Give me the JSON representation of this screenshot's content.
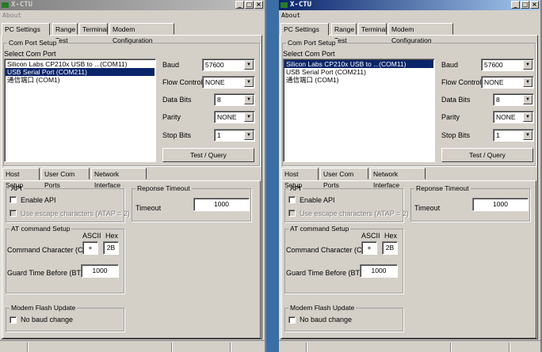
{
  "windows": [
    {
      "title": "X-CTU",
      "active": false,
      "menu": {
        "about": "About"
      },
      "tabs": [
        "PC Settings",
        "Range Test",
        "Terminal",
        "Modem Configuration"
      ],
      "com_port_setup": {
        "group_label": "Com Port Setup",
        "select_label": "Select Com Port",
        "ports": [
          "Silicon Labs CP210x USB to ...(COM11)",
          "USB Serial Port (COM211)",
          "通信端口 (COM1)"
        ],
        "selected_index": 1,
        "baud": {
          "label": "Baud",
          "value": "57600"
        },
        "flow_control": {
          "label": "Flow Control",
          "value": "NONE"
        },
        "data_bits": {
          "label": "Data Bits",
          "value": "8"
        },
        "parity": {
          "label": "Parity",
          "value": "NONE"
        },
        "stop_bits": {
          "label": "Stop Bits",
          "value": "1"
        },
        "test_query": "Test / Query"
      },
      "sub_tabs": [
        "Host Setup",
        "User Com Ports",
        "Network Interface"
      ],
      "api": {
        "group_label": "API",
        "enable_api": "Enable API",
        "escape_chars": "Use escape characters (ATAP = 2)"
      },
      "timeout": {
        "group_label": "Reponse Timeout",
        "label": "Timeout",
        "value": "1000"
      },
      "at_setup": {
        "group_label": "AT command Setup",
        "ascii_label": "ASCII",
        "hex_label": "Hex",
        "cc_label": "Command Character (CC)",
        "cc_ascii": "+",
        "cc_hex": "2B",
        "bt_label": "Guard Time Before (BT)",
        "bt_value": "1000"
      },
      "flash": {
        "group_label": "Modem Flash Update",
        "no_baud_change": "No baud change"
      }
    },
    {
      "title": "X-CTU",
      "active": true,
      "menu": {
        "about": "About"
      },
      "tabs": [
        "PC Settings",
        "Range Test",
        "Terminal",
        "Modem Configuration"
      ],
      "com_port_setup": {
        "group_label": "Com Port Setup",
        "select_label": "Select Com Port",
        "ports": [
          "Silicon Labs CP210x USB to ...(COM11)",
          "USB Serial Port (COM211)",
          "通信端口 (COM1)"
        ],
        "selected_index": 0,
        "baud": {
          "label": "Baud",
          "value": "57600"
        },
        "flow_control": {
          "label": "Flow Control",
          "value": "NONE"
        },
        "data_bits": {
          "label": "Data Bits",
          "value": "8"
        },
        "parity": {
          "label": "Parity",
          "value": "NONE"
        },
        "stop_bits": {
          "label": "Stop Bits",
          "value": "1"
        },
        "test_query": "Test / Query"
      },
      "sub_tabs": [
        "Host Setup",
        "User Com Ports",
        "Network Interface"
      ],
      "api": {
        "group_label": "API",
        "enable_api": "Enable API",
        "escape_chars": "Use escape characters (ATAP = 2)"
      },
      "timeout": {
        "group_label": "Reponse Timeout",
        "label": "Timeout",
        "value": "1000"
      },
      "at_setup": {
        "group_label": "AT command Setup",
        "ascii_label": "ASCII",
        "hex_label": "Hex",
        "cc_label": "Command Character (CC)",
        "cc_ascii": "+",
        "cc_hex": "2B",
        "bt_label": "Guard Time Before (BT)",
        "bt_value": "1000"
      },
      "flash": {
        "group_label": "Modem Flash Update",
        "no_baud_change": "No baud change"
      }
    }
  ]
}
